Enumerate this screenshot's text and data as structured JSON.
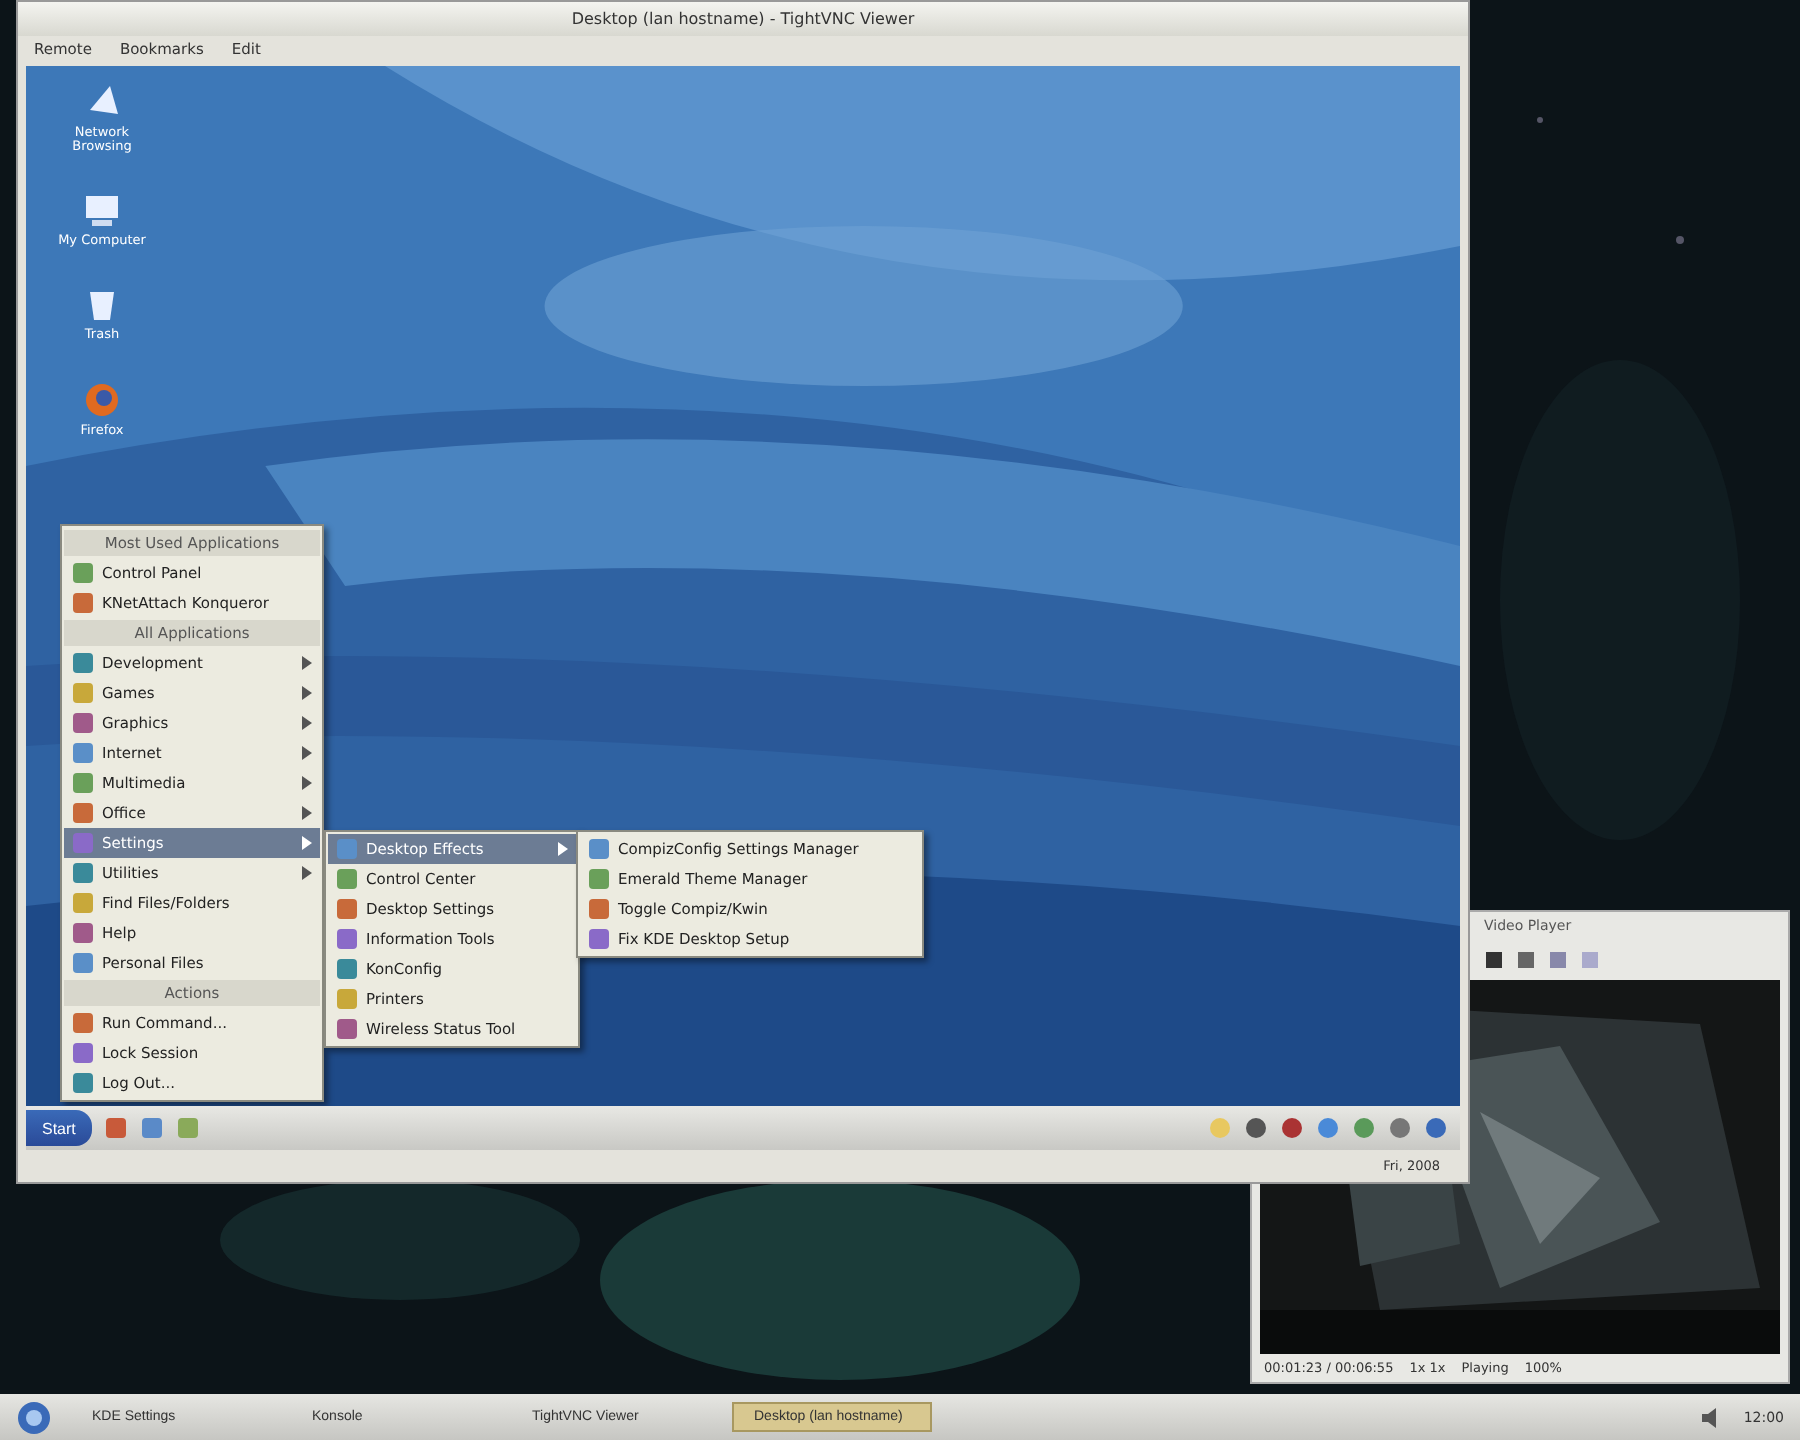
{
  "vnc_window": {
    "title": "Desktop (lan hostname) - TightVNC Viewer",
    "menu_bar": [
      "Remote",
      "Bookmarks",
      "Edit"
    ],
    "desktop_icons": [
      {
        "label": "Network Browsing"
      },
      {
        "label": "My Computer"
      },
      {
        "label": "Trash"
      },
      {
        "label": "Firefox"
      }
    ],
    "start_menu": [
      {
        "kind": "header",
        "label": "Most Used Applications"
      },
      {
        "kind": "item",
        "label": "Control Panel",
        "submenu": false,
        "selected": false
      },
      {
        "kind": "item",
        "label": "KNetAttach Konqueror",
        "submenu": false,
        "selected": false
      },
      {
        "kind": "header",
        "label": "All Applications"
      },
      {
        "kind": "item",
        "label": "Development",
        "submenu": true,
        "selected": false
      },
      {
        "kind": "item",
        "label": "Games",
        "submenu": true,
        "selected": false
      },
      {
        "kind": "item",
        "label": "Graphics",
        "submenu": true,
        "selected": false
      },
      {
        "kind": "item",
        "label": "Internet",
        "submenu": true,
        "selected": false
      },
      {
        "kind": "item",
        "label": "Multimedia",
        "submenu": true,
        "selected": false
      },
      {
        "kind": "item",
        "label": "Office",
        "submenu": true,
        "selected": false
      },
      {
        "kind": "item",
        "label": "Settings",
        "submenu": true,
        "selected": true
      },
      {
        "kind": "item",
        "label": "Utilities",
        "submenu": true,
        "selected": false
      },
      {
        "kind": "item",
        "label": "Find Files/Folders",
        "submenu": false,
        "selected": false
      },
      {
        "kind": "item",
        "label": "Help",
        "submenu": false,
        "selected": false
      },
      {
        "kind": "item",
        "label": "Personal Files",
        "submenu": false,
        "selected": false
      },
      {
        "kind": "header",
        "label": "Actions"
      },
      {
        "kind": "item",
        "label": "Run Command...",
        "submenu": false,
        "selected": false
      },
      {
        "kind": "item",
        "label": "Lock Session",
        "submenu": false,
        "selected": false
      },
      {
        "kind": "item",
        "label": "Log Out...",
        "submenu": false,
        "selected": false
      }
    ],
    "settings_menu": [
      {
        "kind": "item",
        "label": "Desktop Effects",
        "submenu": true,
        "selected": true
      },
      {
        "kind": "item",
        "label": "Control Center",
        "submenu": false,
        "selected": false
      },
      {
        "kind": "item",
        "label": "Desktop Settings",
        "submenu": false,
        "selected": false
      },
      {
        "kind": "item",
        "label": "Information Tools",
        "submenu": false,
        "selected": false
      },
      {
        "kind": "item",
        "label": "KonConfig",
        "submenu": false,
        "selected": false
      },
      {
        "kind": "item",
        "label": "Printers",
        "submenu": false,
        "selected": false
      },
      {
        "kind": "item",
        "label": "Wireless Status Tool",
        "submenu": false,
        "selected": false
      }
    ],
    "effects_menu": [
      {
        "kind": "item",
        "label": "CompizConfig Settings Manager",
        "submenu": false,
        "selected": false
      },
      {
        "kind": "item",
        "label": "Emerald Theme Manager",
        "submenu": false,
        "selected": false
      },
      {
        "kind": "item",
        "label": "Toggle Compiz/Kwin",
        "submenu": false,
        "selected": false
      },
      {
        "kind": "item",
        "label": "Fix KDE Desktop Setup",
        "submenu": false,
        "selected": false
      }
    ],
    "start_button": "Start",
    "clock": "Fri, 2008"
  },
  "video_window": {
    "title": "Video Player",
    "status": [
      "00:01:23 / 00:06:55",
      "1x 1x",
      "Playing",
      "100%"
    ]
  },
  "host_taskbar": {
    "tasks": [
      {
        "label": "KDE Settings",
        "selected": false
      },
      {
        "label": "Konsole",
        "selected": false
      },
      {
        "label": "TightVNC Viewer",
        "selected": false
      },
      {
        "label": "Desktop (lan hostname)",
        "selected": true
      }
    ],
    "clock": "12:00"
  }
}
